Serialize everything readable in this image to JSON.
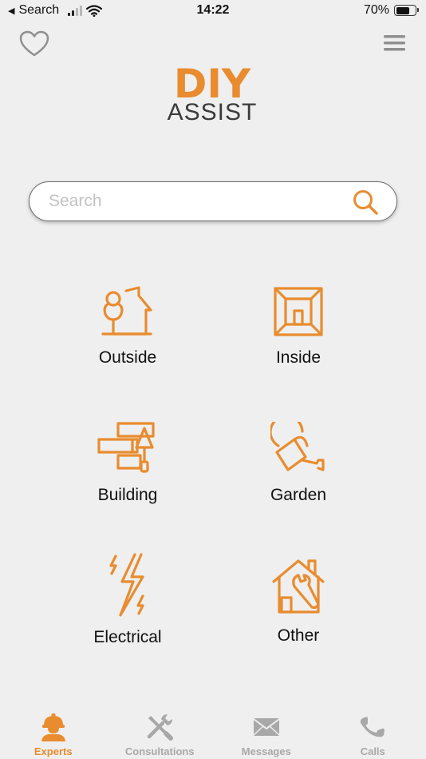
{
  "status_bar": {
    "back_label": "Search",
    "time": "14:22",
    "battery": "70%",
    "battery_level": 0.7
  },
  "brand": {
    "logo_top": "DIY",
    "logo_sub": "ASSIST",
    "accent": "#e88c2f"
  },
  "search": {
    "placeholder": "Search",
    "value": ""
  },
  "categories": [
    {
      "label": "Outside",
      "icon": "house-tree-icon"
    },
    {
      "label": "Inside",
      "icon": "room-icon"
    },
    {
      "label": "Building",
      "icon": "bricks-trowel-icon"
    },
    {
      "label": "Garden",
      "icon": "watering-can-icon"
    },
    {
      "label": "Electrical",
      "icon": "lightning-icon"
    },
    {
      "label": "Other",
      "icon": "house-wrench-icon"
    }
  ],
  "tabs": [
    {
      "label": "Experts",
      "icon": "worker-icon",
      "active": true
    },
    {
      "label": "Consultations",
      "icon": "tools-icon",
      "active": false
    },
    {
      "label": "Messages",
      "icon": "envelope-icon",
      "active": false
    },
    {
      "label": "Calls",
      "icon": "phone-icon",
      "active": false
    }
  ]
}
